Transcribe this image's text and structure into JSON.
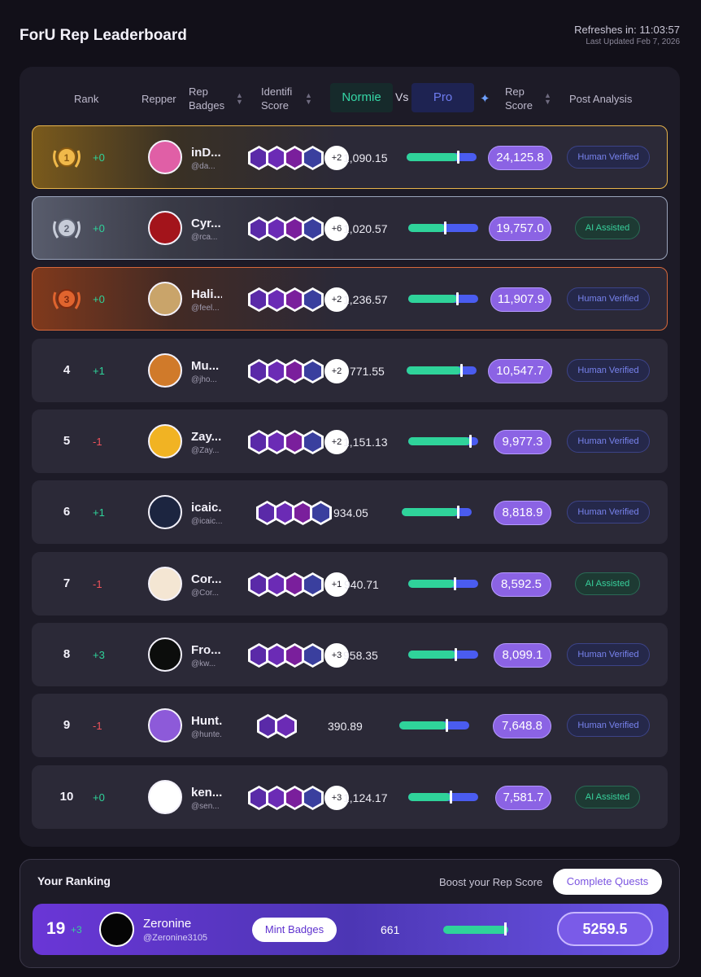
{
  "header": {
    "title": "ForU Rep Leaderboard",
    "refresh_text": "Refreshes in: 11:03:57",
    "updated_text": "Last Updated Feb 7, 2026"
  },
  "columns": {
    "rank": "Rank",
    "repper": "Repper",
    "rep_badges": "Rep Badges",
    "identifi_score": "Identifi Score",
    "normie": "Normie",
    "vs": "Vs",
    "pro": "Pro",
    "rep_score": "Rep Score",
    "post_analysis": "Post Analysis"
  },
  "colors": {
    "accent_purple": "#8b63e4",
    "normie_green": "#2fd39a",
    "pro_blue": "#4a5cf0",
    "gold": "#e6b34a",
    "silver": "#9aa4bb",
    "bronze": "#d7683a"
  },
  "rows": [
    {
      "rank": "1",
      "delta": "+0",
      "delta_kind": "zero",
      "name": "inD...",
      "handle": "@da...",
      "badge_count": 4,
      "extra_badges": "+2",
      "identifi_score": "1,090.15",
      "normie_fraction": 0.73,
      "rep_score": "24,125.8",
      "analysis": "Human Verified",
      "avatar_color": "#e05fa6",
      "medal": "gold"
    },
    {
      "rank": "2",
      "delta": "+0",
      "delta_kind": "zero",
      "name": "Cyr...",
      "handle": "@rca...",
      "badge_count": 4,
      "extra_badges": "+6",
      "identifi_score": "1,020.57",
      "normie_fraction": 0.52,
      "rep_score": "19,757.0",
      "analysis": "AI Assisted",
      "avatar_color": "#a3141b",
      "medal": "silver"
    },
    {
      "rank": "3",
      "delta": "+0",
      "delta_kind": "zero",
      "name": "Hali...",
      "handle": "@feel...",
      "badge_count": 4,
      "extra_badges": "+2",
      "identifi_score": "1,236.57",
      "normie_fraction": 0.7,
      "rep_score": "11,907.9",
      "analysis": "Human Verified",
      "avatar_color": "#c9a46a",
      "medal": "bronze"
    },
    {
      "rank": "4",
      "delta": "+1",
      "delta_kind": "pos",
      "name": "Mu...",
      "handle": "@jho...",
      "badge_count": 4,
      "extra_badges": "+2",
      "identifi_score": "771.55",
      "normie_fraction": 0.78,
      "rep_score": "10,547.7",
      "analysis": "Human Verified",
      "avatar_color": "#d07a2a",
      "medal": ""
    },
    {
      "rank": "5",
      "delta": "-1",
      "delta_kind": "neg",
      "name": "Zay...",
      "handle": "@Zay...",
      "badge_count": 4,
      "extra_badges": "+2",
      "identifi_score": "1,151.13",
      "normie_fraction": 0.88,
      "rep_score": "9,977.3",
      "analysis": "Human Verified",
      "avatar_color": "#f1b323",
      "medal": ""
    },
    {
      "rank": "6",
      "delta": "+1",
      "delta_kind": "pos",
      "name": "icaic...",
      "handle": "@icaic...",
      "badge_count": 4,
      "extra_badges": "",
      "identifi_score": "934.05",
      "normie_fraction": 0.8,
      "rep_score": "8,818.9",
      "analysis": "Human Verified",
      "avatar_color": "#1c2540",
      "medal": ""
    },
    {
      "rank": "7",
      "delta": "-1",
      "delta_kind": "neg",
      "name": "Cor...",
      "handle": "@Cor...",
      "badge_count": 4,
      "extra_badges": "+1",
      "identifi_score": "940.71",
      "normie_fraction": 0.66,
      "rep_score": "8,592.5",
      "analysis": "AI Assisted",
      "avatar_color": "#f4e6d3",
      "medal": ""
    },
    {
      "rank": "8",
      "delta": "+3",
      "delta_kind": "pos",
      "name": "Fro...",
      "handle": "@kw...",
      "badge_count": 4,
      "extra_badges": "+3",
      "identifi_score": "958.35",
      "normie_fraction": 0.67,
      "rep_score": "8,099.1",
      "analysis": "Human Verified",
      "avatar_color": "#0c0d0c",
      "medal": ""
    },
    {
      "rank": "9",
      "delta": "-1",
      "delta_kind": "neg",
      "name": "Hunt...",
      "handle": "@hunte...",
      "badge_count": 2,
      "extra_badges": "",
      "identifi_score": "390.89",
      "normie_fraction": 0.68,
      "rep_score": "7,648.8",
      "analysis": "Human Verified",
      "avatar_color": "#8d5ad9",
      "medal": ""
    },
    {
      "rank": "10",
      "delta": "+0",
      "delta_kind": "zero",
      "name": "ken...",
      "handle": "@sen...",
      "badge_count": 4,
      "extra_badges": "+3",
      "identifi_score": "1,124.17",
      "normie_fraction": 0.6,
      "rep_score": "7,581.7",
      "analysis": "AI Assisted",
      "avatar_color": "#ffffff",
      "medal": ""
    }
  ],
  "your_ranking": {
    "title": "Your Ranking",
    "boost_text": "Boost your Rep Score",
    "quests_button": "Complete Quests",
    "rank": "19",
    "delta": "+3",
    "name": "Zeronine",
    "handle": "@Zeronine3105",
    "mint_button": "Mint Badges",
    "identifi_score": "661",
    "normie_fraction": 0.96,
    "rep_score": "5259.5"
  }
}
